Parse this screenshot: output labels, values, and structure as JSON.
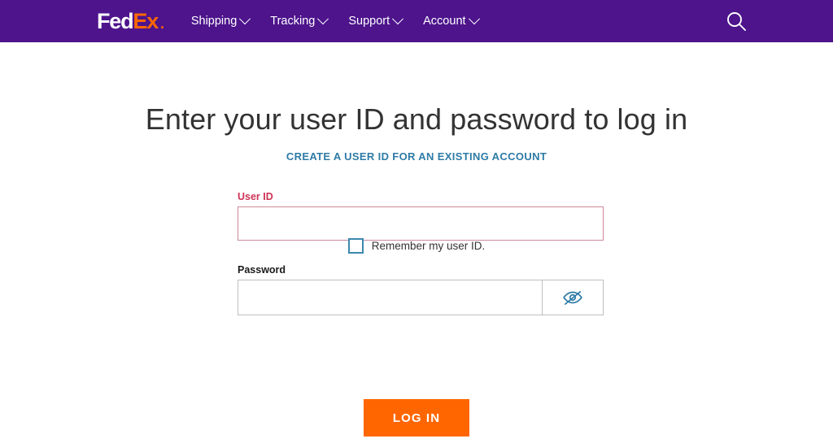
{
  "header": {
    "logo": {
      "part1": "Fed",
      "part2": "Ex",
      "dot": "."
    },
    "nav": [
      {
        "label": "Shipping",
        "icon": "chevron-down-icon"
      },
      {
        "label": "Tracking",
        "icon": "chevron-down-icon"
      },
      {
        "label": "Support",
        "icon": "chevron-down-icon"
      },
      {
        "label": "Account",
        "icon": "chevron-down-icon"
      }
    ],
    "search": {
      "icon": "search-icon"
    },
    "background_color": "#4D148C"
  },
  "main": {
    "title": "Enter your user ID and password to log in",
    "create_account_link": "CREATE A USER ID FOR AN EXISTING ACCOUNT",
    "link_color": "#2e7ba6",
    "fields": {
      "user_id": {
        "label": "User ID",
        "value": "",
        "placeholder": "",
        "state": "error",
        "label_color": "#cc3355",
        "border_color": "#cc8899"
      },
      "password": {
        "label": "Password",
        "value": "",
        "placeholder": "",
        "state": "normal",
        "label_color": "#1a1a1a",
        "border_color": "#bfbfbf",
        "toggle_icon": "eye-off-icon",
        "toggle_icon_color": "#2e7ba6"
      }
    },
    "remember": {
      "label": "Remember my user ID.",
      "checked": false,
      "checkbox_color": "#3b88ad"
    },
    "login_button": {
      "label": "LOG IN",
      "background_color": "#FF6600",
      "text_color": "#ffffff"
    }
  }
}
